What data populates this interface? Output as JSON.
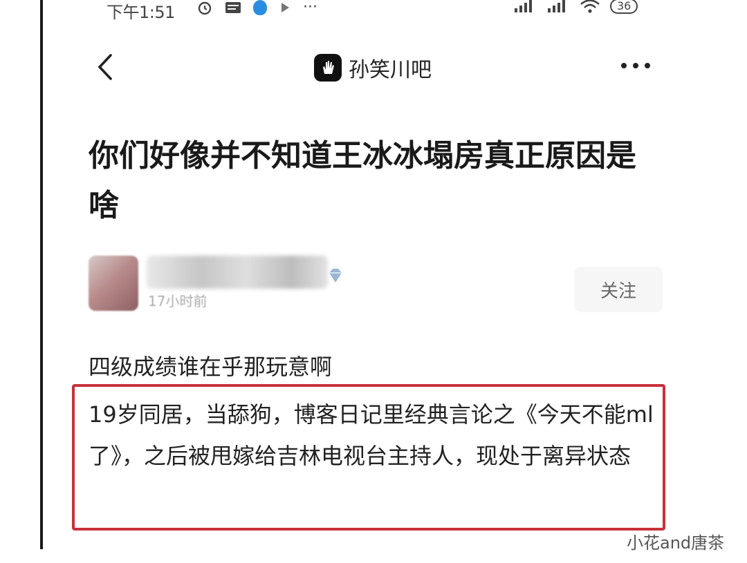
{
  "status_bar": {
    "time": "下午1:51",
    "more": "···",
    "battery": "36"
  },
  "nav": {
    "forum_name": "孙笑川吧"
  },
  "post": {
    "title": "你们好像并不知道王冰冰塌房真正原因是啥",
    "time": "17小时前",
    "follow_label": "关注",
    "line1": "四级成绩谁在乎那玩意啊",
    "highlighted_text": "19岁同居，当舔狗，博客日记里经典言论之《今天不能ml了》，之后被甩嫁给吉林电视台主持人，现处于离异状态"
  },
  "watermark": "小花and唐茶",
  "colors": {
    "highlight_border": "#c8303a",
    "status_bubble": "#2b8de0"
  }
}
